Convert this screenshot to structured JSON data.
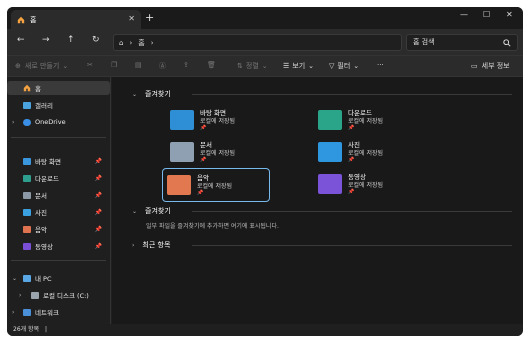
{
  "titlebar": {
    "tab_label": "홈",
    "close_glyph": "✕",
    "new_tab_glyph": "+",
    "minimize": "—",
    "maximize": "☐",
    "close": "✕"
  },
  "nav": {
    "back": "←",
    "forward": "→",
    "up": "↑",
    "refresh": "↻",
    "home_glyph": "⌂",
    "sep1": "›",
    "crumb": "홈",
    "sep2": "›",
    "search_placeholder": "홈 검색"
  },
  "toolbar": {
    "new_label": "새로 만들기",
    "sort_label": "정렬",
    "view_label": "보기",
    "filter_label": "필터",
    "more_label": "···",
    "details_label": "세부 정보"
  },
  "sidebar": {
    "home": "홈",
    "gallery": "갤러리",
    "onedrive": "OneDrive",
    "pinned": [
      {
        "label": "바탕 화면",
        "color": "#3a96dd"
      },
      {
        "label": "다운로드",
        "color": "#2e9f8f"
      },
      {
        "label": "문서",
        "color": "#8c9aa8"
      },
      {
        "label": "사진",
        "color": "#3aa0e0"
      },
      {
        "label": "음악",
        "color": "#e0734f"
      },
      {
        "label": "동영상",
        "color": "#7a4fd6"
      }
    ],
    "pc": "내 PC",
    "local_disk": "로컬 디스크 (C:)",
    "network": "네트워크"
  },
  "main": {
    "quick_access": "즐겨찾기",
    "folders": [
      {
        "name": "바탕 화면",
        "sub": "로컬에 저장됨",
        "color": "#2f8fd6"
      },
      {
        "name": "다운로드",
        "sub": "로컬에 저장됨",
        "color": "#2aa58a"
      },
      {
        "name": "문서",
        "sub": "로컬에 저장됨",
        "color": "#8fa0b3"
      },
      {
        "name": "사진",
        "sub": "로컬에 저장됨",
        "color": "#2f97e0"
      },
      {
        "name": "음악",
        "sub": "로컬에 저장됨",
        "color": "#e2784f"
      },
      {
        "name": "동영상",
        "sub": "로컬에 저장됨",
        "color": "#7b53d8"
      }
    ],
    "favorites": "즐겨찾기",
    "favorites_empty": "일부 파일을 즐겨찾기에 추가하면 여기에 표시됩니다.",
    "recent": "최근 항목"
  },
  "status": {
    "count": "26개 항목",
    "cursor": "|"
  }
}
